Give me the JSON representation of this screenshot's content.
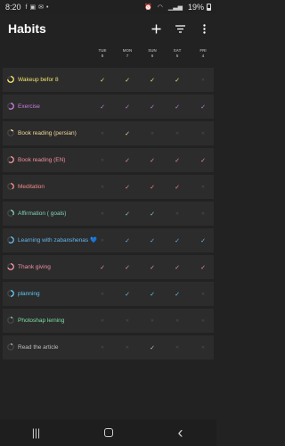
{
  "status": {
    "time": "8:20",
    "notif_icons": [
      "facebook-icon",
      "image-icon",
      "messenger-icon",
      "more-dots-icon"
    ],
    "battery": "19%"
  },
  "appbar": {
    "title": "Habits",
    "add_icon": "plus-icon",
    "filter_icon": "filter-icon",
    "menu_icon": "more-vert-icon"
  },
  "days": [
    {
      "name": "TUE",
      "num": "8"
    },
    {
      "name": "MON",
      "num": "7"
    },
    {
      "name": "SUN",
      "num": "6"
    },
    {
      "name": "SAT",
      "num": "5"
    },
    {
      "name": "FRI",
      "num": "4"
    }
  ],
  "habits": [
    {
      "name": "Wakeup befor 8",
      "color": "#f2e46e",
      "progress": 0.75,
      "checks": [
        true,
        true,
        true,
        true,
        false
      ]
    },
    {
      "name": "Exercise",
      "color": "#c77ddf",
      "progress": 0.6,
      "checks": [
        true,
        true,
        true,
        true,
        true
      ]
    },
    {
      "name": "Book reading (persian)",
      "color": "#f2d89a",
      "progress": 0.15,
      "checks": [
        false,
        true,
        false,
        false,
        false
      ]
    },
    {
      "name": "Book reading (EN)",
      "color": "#ef8fa0",
      "progress": 0.6,
      "checks": [
        false,
        true,
        true,
        true,
        true
      ]
    },
    {
      "name": "Meditation",
      "color": "#f58a8a",
      "progress": 0.4,
      "checks": [
        false,
        true,
        true,
        true,
        false
      ]
    },
    {
      "name": "Affirmation ( goals)",
      "color": "#7fd4b4",
      "progress": 0.35,
      "checks": [
        false,
        true,
        true,
        false,
        false
      ]
    },
    {
      "name": "Learning with zabanshenas 💙",
      "color": "#63b7ec",
      "progress": 0.6,
      "checks": [
        false,
        true,
        true,
        true,
        true
      ]
    },
    {
      "name": "Thank giving",
      "color": "#f08fa6",
      "progress": 0.7,
      "checks": [
        true,
        true,
        true,
        true,
        true
      ]
    },
    {
      "name": "planning",
      "color": "#5ec9f2",
      "progress": 0.5,
      "checks": [
        false,
        true,
        true,
        true,
        false
      ]
    },
    {
      "name": "Photoshap lerning",
      "color": "#7ee0a0",
      "progress": 0.1,
      "checks": [
        false,
        false,
        false,
        false,
        false
      ]
    },
    {
      "name": "Read the article",
      "color": "#bdbdbd",
      "progress": 0.1,
      "checks": [
        false,
        false,
        true,
        false,
        false
      ]
    }
  ],
  "marks": {
    "check": "✓",
    "off": "✕"
  },
  "navbar": {
    "recents_icon": "recents-icon",
    "home_icon": "home-icon",
    "back_icon": "back-icon",
    "recents": "|||",
    "back": "‹"
  }
}
